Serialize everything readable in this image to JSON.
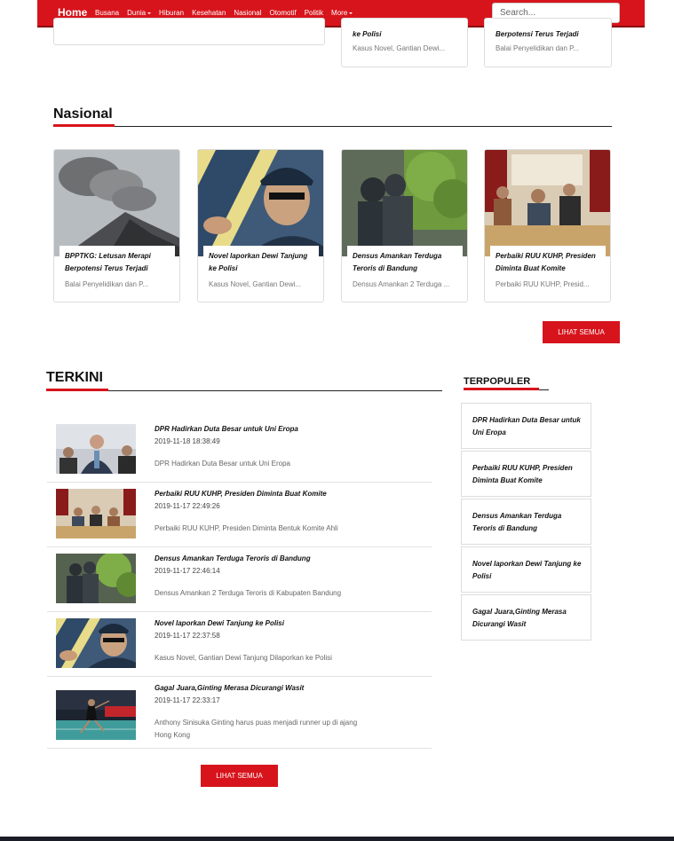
{
  "navbar": {
    "home": "Home",
    "items": [
      {
        "label": "Busana",
        "dropdown": false
      },
      {
        "label": "Dunia",
        "dropdown": true
      },
      {
        "label": "Hiburan",
        "dropdown": false
      },
      {
        "label": "Kesehatan",
        "dropdown": false
      },
      {
        "label": "Nasional",
        "dropdown": false
      },
      {
        "label": "Otomotif",
        "dropdown": false
      },
      {
        "label": "Politik",
        "dropdown": false
      },
      {
        "label": "More",
        "dropdown": true
      }
    ],
    "search_placeholder": "Search..."
  },
  "top_cards": [
    {
      "title_line": "ke Polisi",
      "sub": "Kasus Novel, Gantian Dewi..."
    },
    {
      "title_line": "Berpotensi Terus Terjadi",
      "sub": "Balai Penyelidikan dan P..."
    }
  ],
  "nasional": {
    "title": "Nasional",
    "cards": [
      {
        "title": "BPPTKG: Letusan Merapi Berpotensi Terus Terjadi",
        "sub": "Balai Penyelidikan dan P..."
      },
      {
        "title": "Novel laporkan Dewi Tanjung ke Polisi",
        "sub": "Kasus Novel, Gantian Dewi..."
      },
      {
        "title": "Densus Amankan Terduga Teroris di Bandung",
        "sub": "Densus Amankan 2 Terduga ..."
      },
      {
        "title": "Perbaiki RUU KUHP, Presiden Diminta Buat Komite",
        "sub": "Perbaiki RUU KUHP, Presid..."
      }
    ],
    "more_label": "LIHAT SEMUA"
  },
  "terkini": {
    "title": "TERKINI",
    "items": [
      {
        "title": "DPR Hadirkan Duta Besar untuk Uni Eropa",
        "date": "2019-11-18 18:38:49",
        "desc": "DPR Hadirkan Duta Besar untuk Uni Eropa"
      },
      {
        "title": "Perbaiki RUU KUHP, Presiden Diminta Buat Komite",
        "date": "2019-11-17 22:49:26",
        "desc": "Perbaiki RUU KUHP, Presiden Diminta Bentuk Komite Ahli"
      },
      {
        "title": "Densus Amankan Terduga Teroris di Bandung",
        "date": "2019-11-17 22:46:14",
        "desc": "Densus Amankan 2 Terduga Teroris di Kabupaten Bandung"
      },
      {
        "title": "Novel laporkan Dewi Tanjung ke Polisi",
        "date": "2019-11-17 22:37:58",
        "desc": "Kasus Novel, Gantian Dewi Tanjung Dilaporkan ke Polisi"
      },
      {
        "title": "Gagal Juara,Ginting Merasa Dicurangi Wasit",
        "date": "2019-11-17 22:33:17",
        "desc": "Anthony Sinisuka Ginting harus puas menjadi runner up di ajang Hong Kong"
      }
    ],
    "more_label": "LIHAT SEMUA"
  },
  "terpopuler": {
    "title": "TERPOPULER",
    "items": [
      "DPR Hadirkan Duta Besar untuk Uni Eropa",
      "Perbaiki RUU KUHP, Presiden Diminta Buat Komite",
      "Densus Amankan Terduga Teroris di Bandung",
      "Novel laporkan Dewi Tanjung ke Polisi",
      "Gagal Juara,Ginting Merasa Dicurangi Wasit"
    ]
  },
  "colors": {
    "accent": "#d7141c",
    "footer": "#1a1d26"
  }
}
